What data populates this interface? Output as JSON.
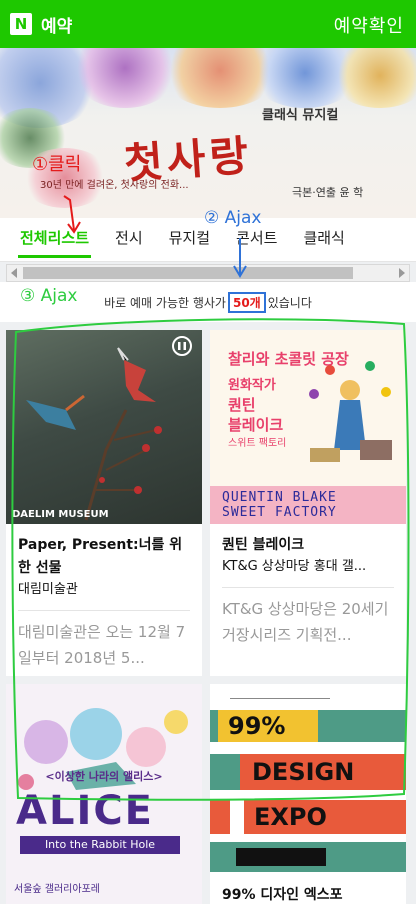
{
  "header": {
    "logo_letter": "N",
    "title": "예약",
    "confirm_label": "예약확인"
  },
  "banner": {
    "subtitle": "클래식 뮤지컬",
    "headline": "첫사랑",
    "description": "30년 만에 걸려온, 첫사랑의 전화...",
    "credit": "극본·연출 윤 학"
  },
  "tabs": [
    {
      "label": "전체리스트"
    },
    {
      "label": "전시"
    },
    {
      "label": "뮤지컬"
    },
    {
      "label": "콘서트"
    },
    {
      "label": "클래식"
    }
  ],
  "countline": {
    "prefix": "바로 예매 가능한 행사가",
    "count": "50개",
    "suffix": "있습니다"
  },
  "cards": [
    {
      "title": "Paper, Present:너를 위한 선물",
      "venue": "대림미술관",
      "description": "대림미술관은 오는 12월 7일부터 2018년 5...",
      "image_text": "DAELIM MUSEUM"
    },
    {
      "title": "퀀틴 블레이크",
      "venue": "KT&G 상상마당 홍대 갤...",
      "description": "KT&G 상상마당은 20세기 거장시리즈 기획전...",
      "image_top": "찰리와 초콜릿 공장",
      "image_sub1": "원화작가",
      "image_sub2": "퀀틴",
      "image_sub3": "블레이크",
      "image_sub4": "스위트 팩토리",
      "image_band1": "QUENTIN BLAKE",
      "image_band2": "SWEET FACTORY"
    },
    {
      "title": "",
      "image_caption": "<이상한 나라의 앨리스>",
      "image_big": "ALICE",
      "image_strip": "Into the Rabbit Hole",
      "image_footer": "서울숲 갤러리아포레"
    },
    {
      "title": "99% 디자인 엑스포",
      "image_band1": "99%",
      "image_band2": "DESIGN",
      "image_band3": "EXPO"
    }
  ],
  "annotations": {
    "note1": "①클릭",
    "note2": "② Ajax",
    "note3": "③ Ajax"
  },
  "colors": {
    "brand": "#1ec800",
    "annotation_red": "#e41b1b",
    "annotation_blue": "#2f72d7",
    "annotation_green": "#2ecc40"
  }
}
